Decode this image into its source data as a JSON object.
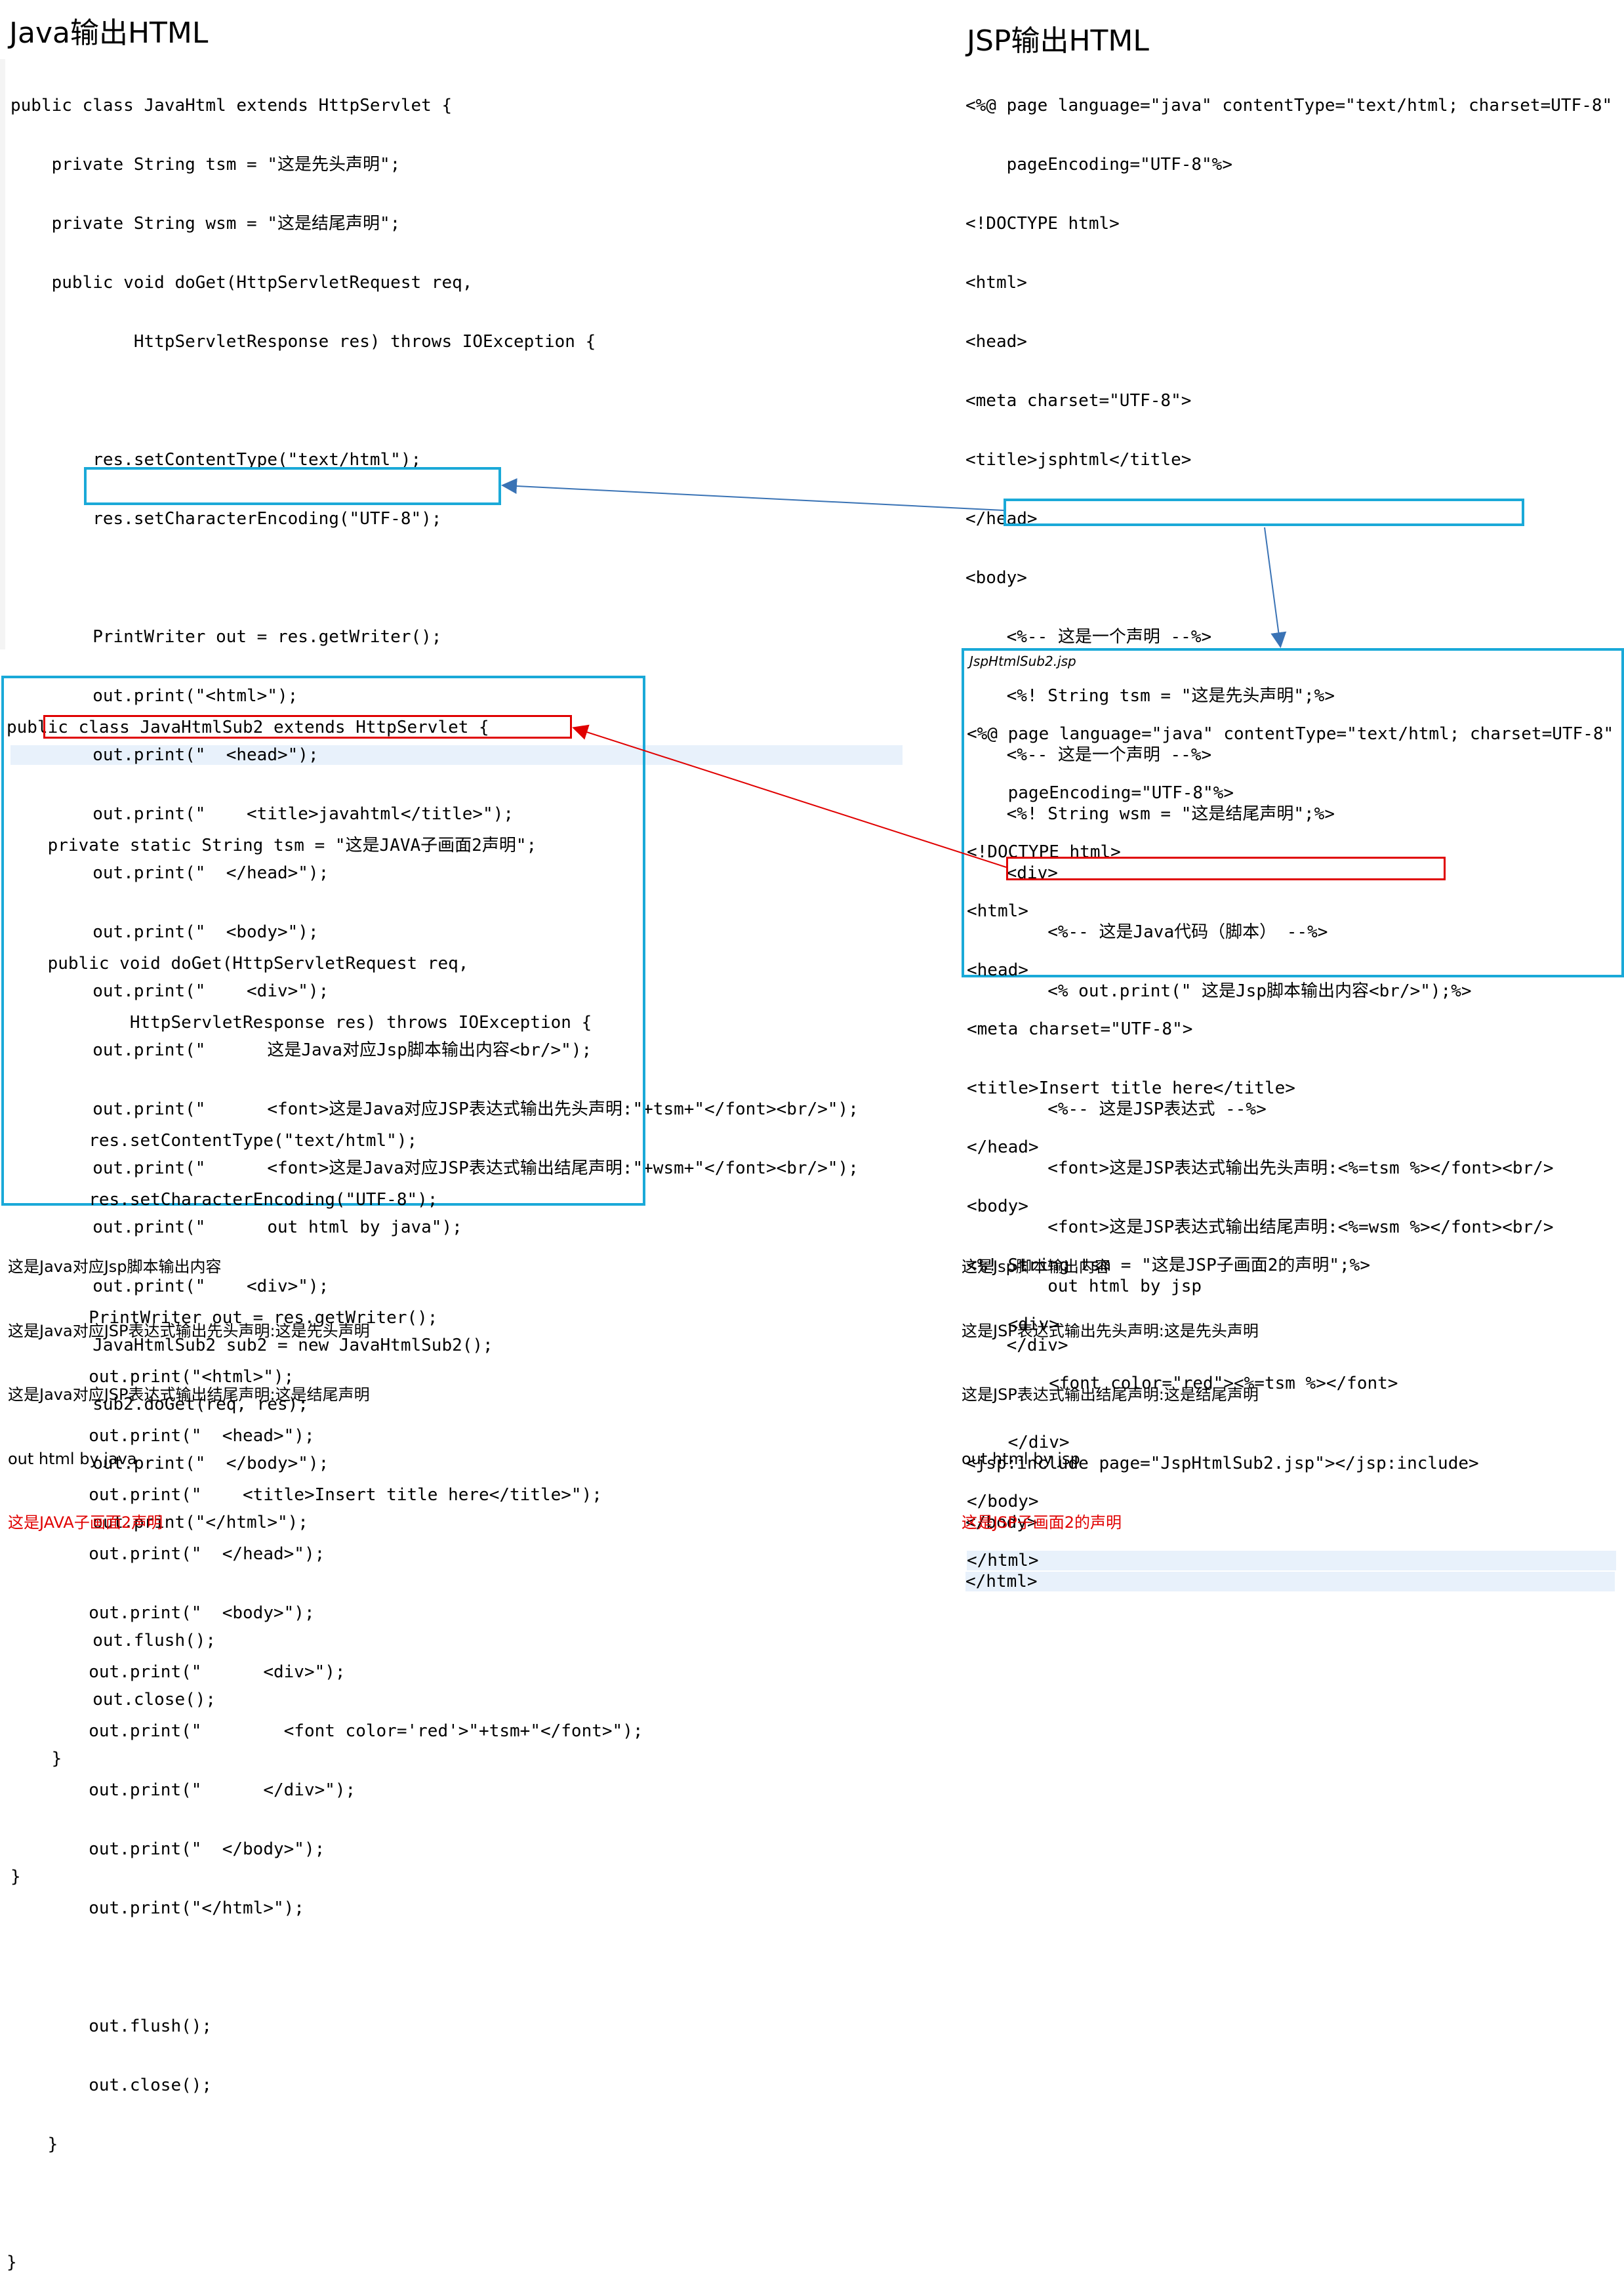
{
  "java_section": {
    "title": "Java输出HTML",
    "code_lines": [
      "public class JavaHtml extends HttpServlet {",
      "    private String tsm = \"这是先头声明\";",
      "    private String wsm = \"这是结尾声明\";",
      "    public void doGet(HttpServletRequest req,",
      "            HttpServletResponse res) throws IOException {",
      "",
      "        res.setContentType(\"text/html\");",
      "        res.setCharacterEncoding(\"UTF-8\");",
      "",
      "        PrintWriter out = res.getWriter();",
      "        out.print(\"<html>\");",
      "        out.print(\"  <head>\");",
      "        out.print(\"    <title>javahtml</title>\");",
      "        out.print(\"  </head>\");",
      "        out.print(\"  <body>\");",
      "        out.print(\"    <div>\");",
      "        out.print(\"      这是Java对应Jsp脚本输出内容<br/>\");",
      "        out.print(\"      <font>这是Java对应JSP表达式输出先头声明:\"+tsm+\"</font><br/>\");",
      "        out.print(\"      <font>这是Java对应JSP表达式输出结尾声明:\"+wsm+\"</font><br/>\");",
      "        out.print(\"      out html by java\");",
      "        out.print(\"    <div>\");",
      "        JavaHtmlSub2 sub2 = new JavaHtmlSub2();",
      "        sub2.doGet(req, res);",
      "        out.print(\"  </body>\");",
      "        out.print(\"</html>\");",
      "",
      "        out.flush();",
      "        out.close();",
      "    }",
      "",
      "}"
    ],
    "output_lines": [
      "这是Java对应Jsp脚本输出内容",
      "这是Java对应JSP表达式输出先头声明:这是先头声明",
      "这是Java对应JSP表达式输出结尾声明:这是结尾声明",
      "out html by java"
    ],
    "output_red_line": "这是JAVA子画面2声明"
  },
  "java_sub_section": {
    "code_lines": [
      "public class JavaHtmlSub2 extends HttpServlet {",
      "",
      "    private static String tsm = \"这是JAVA子画面2声明\";",
      "",
      "    public void doGet(HttpServletRequest req,",
      "            HttpServletResponse res) throws IOException {",
      "",
      "        res.setContentType(\"text/html\");",
      "        res.setCharacterEncoding(\"UTF-8\");",
      "",
      "        PrintWriter out = res.getWriter();",
      "        out.print(\"<html>\");",
      "        out.print(\"  <head>\");",
      "        out.print(\"    <title>Insert title here</title>\");",
      "        out.print(\"  </head>\");",
      "        out.print(\"  <body>\");",
      "        out.print(\"      <div>\");",
      "        out.print(\"        <font color='red'>\"+tsm+\"</font>\");",
      "        out.print(\"      </div>\");",
      "        out.print(\"  </body>\");",
      "        out.print(\"</html>\");",
      "",
      "        out.flush();",
      "        out.close();",
      "    }",
      "",
      "}"
    ]
  },
  "jsp_section": {
    "title": "JSP输出HTML",
    "code_lines": [
      "<%@ page language=\"java\" contentType=\"text/html; charset=UTF-8\"",
      "    pageEncoding=\"UTF-8\"%>",
      "<!DOCTYPE html>",
      "<html>",
      "<head>",
      "<meta charset=\"UTF-8\">",
      "<title>jsphtml</title>",
      "</head>",
      "<body>",
      "    <%-- 这是一个声明 --%>",
      "    <%! String tsm = \"这是先头声明\";%>",
      "    <%-- 这是一个声明 --%>",
      "    <%! String wsm = \"这是结尾声明\";%>",
      "    <div>",
      "        <%-- 这是Java代码（脚本） --%>",
      "        <% out.print(\" 这是Jsp脚本输出内容<br/>\");%>",
      "",
      "        <%-- 这是JSP表达式 --%>",
      "        <font>这是JSP表达式输出先头声明:<%=tsm %></font><br/>",
      "        <font>这是JSP表达式输出结尾声明:<%=wsm %></font><br/>",
      "        out html by jsp",
      "    </div>",
      "",
      "<jsp:include page=\"JspHtmlSub2.jsp\"></jsp:include>",
      "</body>",
      "</html>"
    ],
    "output_lines": [
      "这是Jsp脚本输出内容",
      "这是JSP表达式输出先头声明:这是先头声明",
      "这是JSP表达式输出结尾声明:这是结尾声明",
      "out html by jsp"
    ],
    "output_red_line": "这是JSP子画面2的声明"
  },
  "jsp_sub_section": {
    "file_label": "JspHtmlSub2.jsp",
    "code_lines": [
      "<%@ page language=\"java\" contentType=\"text/html; charset=UTF-8\"",
      "    pageEncoding=\"UTF-8\"%>",
      "<!DOCTYPE html>",
      "<html>",
      "<head>",
      "<meta charset=\"UTF-8\">",
      "<title>Insert title here</title>",
      "</head>",
      "<body>",
      "<%! String tsm = \"这是JSP子画面2的声明\";%>",
      "    <div>",
      "        <font color=\"red\"><%=tsm %></font>",
      "    </div>",
      "</body>",
      "</html>"
    ]
  },
  "colors": {
    "box_blue": "#1aa9d8",
    "box_red": "#e00000",
    "arrow_blue": "#3a73b5",
    "output_red": "#e00000",
    "highlight_line": "#e8f1fb"
  }
}
